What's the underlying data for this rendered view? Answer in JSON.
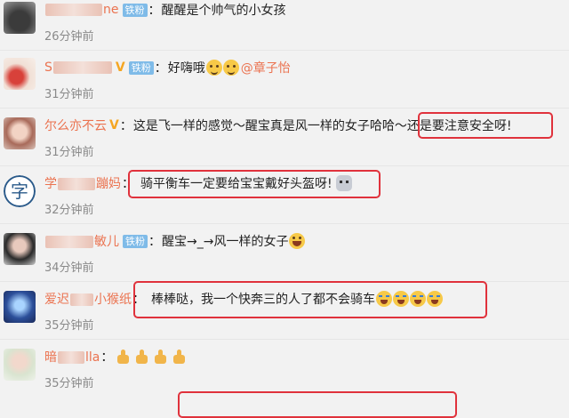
{
  "comments": [
    {
      "name_start": "",
      "name_end": "ne",
      "badge": "铁粉",
      "text": "醒醒是个帅气的小女孩",
      "time": "26分钟前"
    },
    {
      "name_start": "S",
      "name_end": "",
      "badge": "铁粉",
      "text": "好嗨哦",
      "mention": "@章子怡",
      "time": "31分钟前"
    },
    {
      "name_start": "尔么",
      "name_end": "亦不云",
      "text": "这是飞一样的感觉～醒宝真是风一样的女子哈哈～",
      "text2": "还是要注意安全呀!",
      "time": "31分钟前"
    },
    {
      "name_start": "学",
      "name_end": "蹦妈",
      "text": "骑平衡车一定要给宝宝戴好头盔呀!",
      "time": "32分钟前"
    },
    {
      "name_start": "",
      "name_end": "敏儿",
      "badge": "铁粉",
      "text": "醒宝→_→风一样的女子",
      "time": "34分钟前"
    },
    {
      "name_start": "爱迟",
      "name_end": "小猴纸",
      "text": "棒棒哒，我一个快奔三的人了都不会骑车",
      "time": "35分钟前"
    },
    {
      "name_start": "暗",
      "name_end": "lla",
      "text": "",
      "time": "35分钟前"
    }
  ],
  "colors": {
    "name": "#eb7350",
    "badge": "#7fbbe8",
    "highlight": "#e0323c"
  }
}
